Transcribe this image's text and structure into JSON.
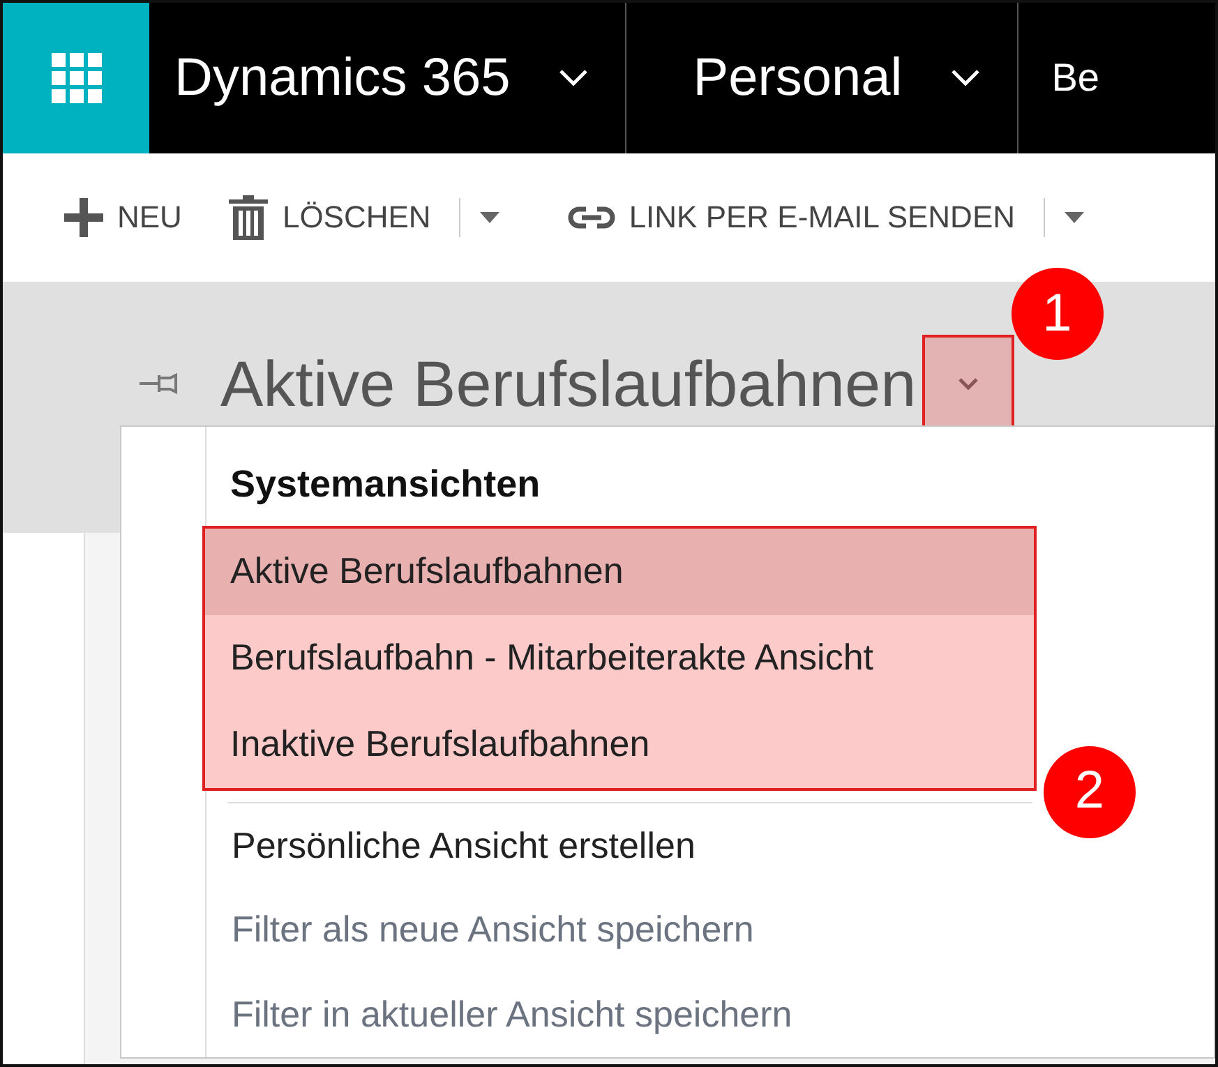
{
  "top_bar": {
    "app_name": "Dynamics 365",
    "area": "Personal",
    "next_area": "Be"
  },
  "toolbar": {
    "buttons": [
      {
        "label": "NEU",
        "kind": "add",
        "split": false
      },
      {
        "label": "LÖSCHEN",
        "kind": "delete",
        "split": true
      },
      {
        "label": "LINK PER E-MAIL SENDEN",
        "kind": "link",
        "split": true
      }
    ]
  },
  "view": {
    "title": "Aktive Berufslaufbahnen",
    "callout": "1"
  },
  "menu": {
    "header": "Systemansichten",
    "callout": "2",
    "system_views": [
      {
        "label": "Aktive Berufslaufbahnen",
        "selected": true
      },
      {
        "label": "Berufslaufbahn - Mitarbeiterakte Ansicht",
        "selected": false
      },
      {
        "label": "Inaktive Berufslaufbahnen",
        "selected": false
      }
    ],
    "actions": [
      {
        "label": "Persönliche Ansicht erstellen",
        "disabled": false
      },
      {
        "label": "Filter als neue Ansicht speichern",
        "disabled": true
      },
      {
        "label": "Filter in aktueller Ansicht speichern",
        "disabled": true
      }
    ]
  }
}
